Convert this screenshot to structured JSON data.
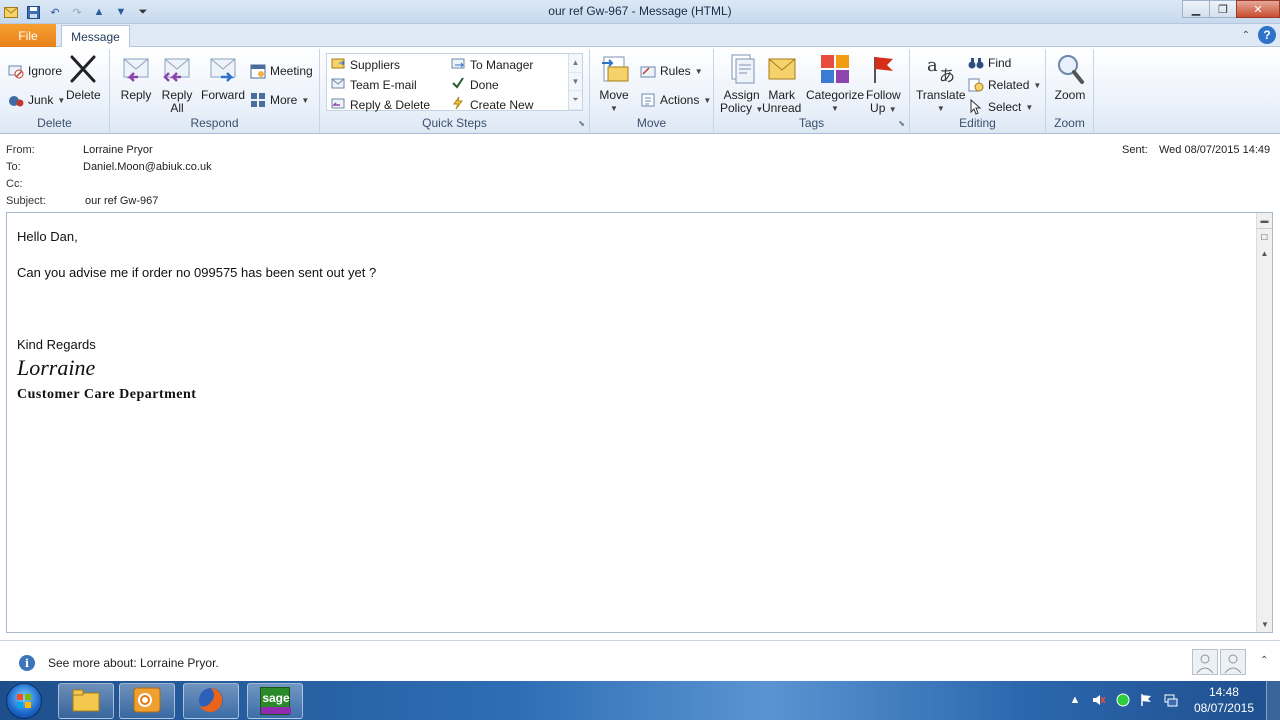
{
  "window": {
    "title": "our ref Gw-967  -  Message (HTML)",
    "minimize": "▁",
    "maximize": "❐",
    "close": "✕"
  },
  "tabs": {
    "file": "File",
    "message": "Message"
  },
  "ribbon": {
    "delete_group": {
      "label": "Delete",
      "ignore": "Ignore",
      "junk": "Junk",
      "delete": "Delete"
    },
    "respond_group": {
      "label": "Respond",
      "reply": "Reply",
      "reply_all_1": "Reply",
      "reply_all_2": "All",
      "forward": "Forward",
      "meeting": "Meeting",
      "more": "More"
    },
    "quick_steps": {
      "label": "Quick Steps",
      "items": [
        "Suppliers",
        "To Manager",
        "Team E-mail",
        "Done",
        "Reply & Delete",
        "Create New"
      ]
    },
    "move_group": {
      "label": "Move",
      "move": "Move",
      "rules": "Rules",
      "actions": "Actions"
    },
    "tags_group": {
      "label": "Tags",
      "assign_1": "Assign",
      "assign_2": "Policy",
      "mark_1": "Mark",
      "mark_2": "Unread",
      "categorize": "Categorize",
      "follow_1": "Follow",
      "follow_2": "Up"
    },
    "editing_group": {
      "label": "Editing",
      "translate": "Translate",
      "find": "Find",
      "related": "Related",
      "select": "Select"
    },
    "zoom_group": {
      "label": "Zoom",
      "zoom": "Zoom"
    }
  },
  "header": {
    "from_label": "From:",
    "from": "Lorraine Pryor",
    "to_label": "To:",
    "to": "Daniel.Moon@abiuk.co.uk",
    "cc_label": "Cc:",
    "cc": "",
    "subject_label": "Subject:",
    "subject": "our ref Gw-967",
    "sent_label": "Sent:",
    "sent": "Wed 08/07/2015 14:49"
  },
  "message": {
    "greeting": "Hello Dan,",
    "line1": "Can you advise me if order no 099575 has been sent out yet ?",
    "closing": "Kind Regards",
    "signature": "Lorraine",
    "department": "Customer Care Department"
  },
  "people_pane": {
    "text": "See more about: Lorraine Pryor."
  },
  "taskbar": {
    "time": "14:48",
    "date": "08/07/2015",
    "sage": "sage"
  }
}
